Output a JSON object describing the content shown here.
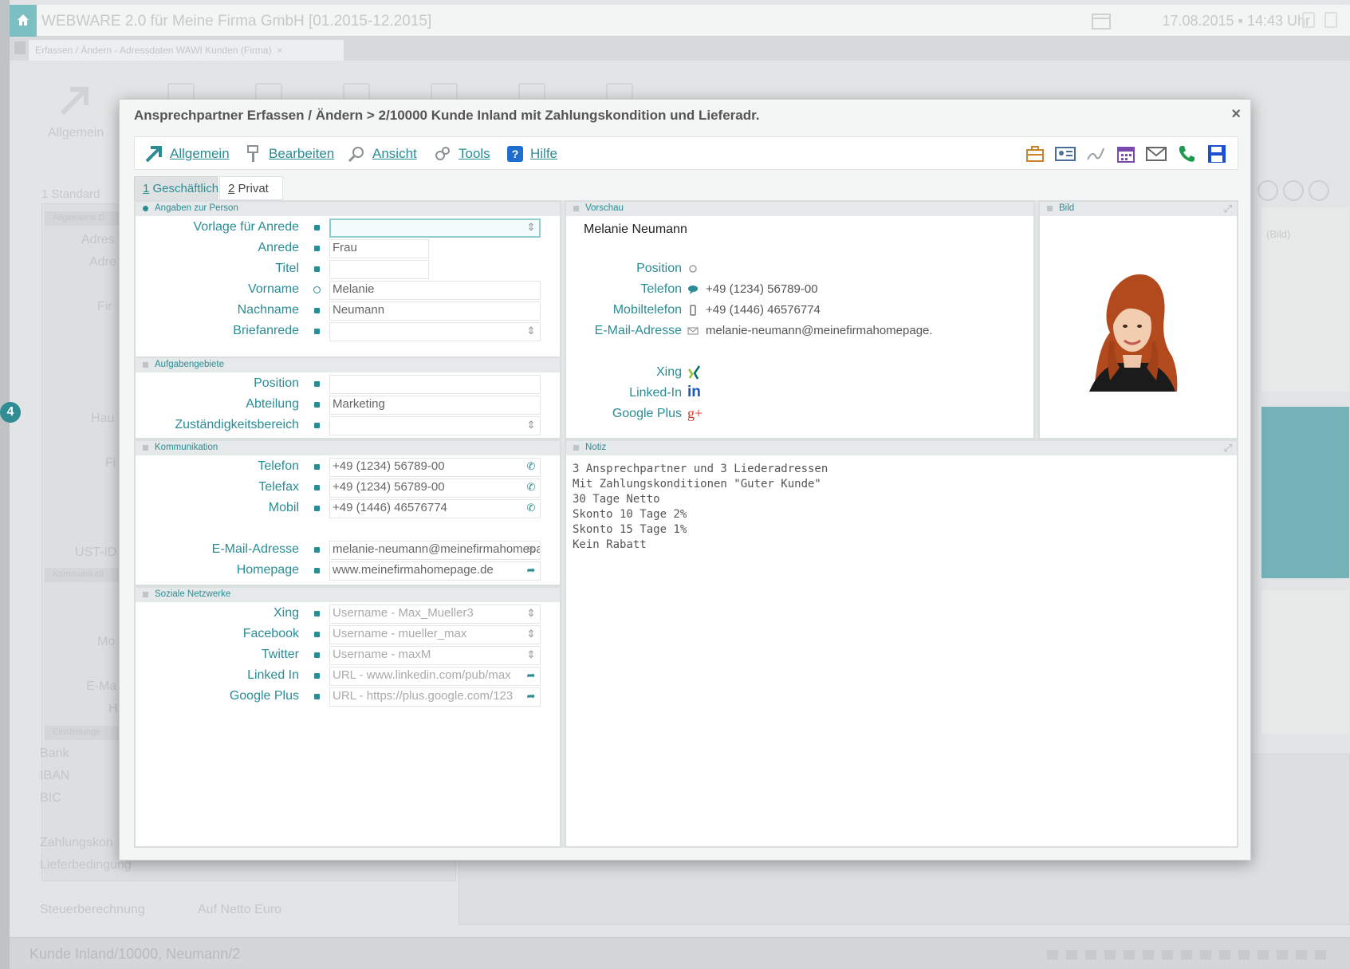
{
  "app": {
    "title": "WEBWARE 2.0 für Meine Firma GmbH  [01.2015-12.2015]",
    "datetime": "17.08.2015 ▪ 14:43 Uhr",
    "tab_label": "Erfassen / Ändern - Adressdaten WAWI Kunden (Firma)",
    "ghost_toolbar_label": "Allgemein",
    "ghost_standard_tab": "1 Standard",
    "bg_labels": [
      "Adres",
      "Adre",
      "Fir",
      "Hau",
      "Fi",
      "UST-ID",
      "Mo",
      "E-Ma",
      "H",
      "Bank",
      "IBAN",
      "BIC",
      "Zahlungskon",
      "Lieferbedingung",
      "Steuerberechnung",
      "Auf Netto Euro"
    ],
    "bg_section_labels": [
      "Allgemeine D",
      "Kommunikati",
      "Einstellunge"
    ],
    "bg_right_note": "(Bild)",
    "status_text": "Kunde Inland/10000, Neumann/2",
    "step_badge": "4",
    "accent_color": "#2a8d94"
  },
  "dialog": {
    "title": "Ansprechpartner Erfassen / Ändern > 2/10000 Kunde Inland mit Zahlungskondition und Lieferadr.",
    "close": "×",
    "toolbar": {
      "allgemein": "Allgemein",
      "bearbeiten": "Bearbeiten",
      "ansicht": "Ansicht",
      "tools": "Tools",
      "hilfe": "Hilfe",
      "right_icons": [
        "briefcase-icon",
        "contact-card-icon",
        "signature-icon",
        "calendar-icon",
        "mail-icon",
        "phone-icon",
        "save-icon"
      ]
    },
    "tabs": [
      {
        "num": "1",
        "label": " Geschäftlich"
      },
      {
        "num": "2",
        "label": " Privat"
      }
    ],
    "sections": {
      "person": "Angaben zur Person",
      "tasks": "Aufgabengebiete",
      "comm": "Kommunikation",
      "social": "Soziale Netzwerke",
      "preview": "Vorschau",
      "picture": "Bild",
      "note": "Notiz"
    },
    "person": {
      "vorlage_label": "Vorlage für Anrede",
      "vorlage_value": "",
      "anrede_label": "Anrede",
      "anrede_value": "Frau",
      "titel_label": "Titel",
      "titel_value": "",
      "vorname_label": "Vorname",
      "vorname_value": "Melanie",
      "nachname_label": "Nachname",
      "nachname_value": "Neumann",
      "brief_label": "Briefanrede",
      "brief_value": ""
    },
    "tasks": {
      "position_label": "Position",
      "position_value": "",
      "abteilung_label": "Abteilung",
      "abteilung_value": "Marketing",
      "zust_label": "Zuständigkeitsbereich",
      "zust_value": ""
    },
    "comm": {
      "telefon_label": "Telefon",
      "telefon_value": "+49 (1234) 56789-00",
      "telefax_label": "Telefax",
      "telefax_value": "+49 (1234) 56789-00",
      "mobil_label": "Mobil",
      "mobil_value": "+49 (1446) 46576774",
      "email_label": "E-Mail-Adresse",
      "email_value": "melanie-neumann@meinefirmahomepage.de",
      "homepage_label": "Homepage",
      "homepage_value": "www.meinefirmahomepage.de"
    },
    "social": {
      "xing_label": "Xing",
      "xing_placeholder": "Username - Max_Mueller3",
      "facebook_label": "Facebook",
      "facebook_placeholder": "Username - mueller_max",
      "twitter_label": "Twitter",
      "twitter_placeholder": "Username - maxM",
      "linkedin_label": "Linked In",
      "linkedin_placeholder": "URL - www.linkedin.com/pub/max",
      "gplus_label": "Google Plus",
      "gplus_placeholder": "URL - https://plus.google.com/123"
    },
    "preview": {
      "name": "Melanie Neumann",
      "position_label": "Position",
      "position_value": "",
      "telefon_label": "Telefon",
      "telefon_value": "+49 (1234) 56789-00",
      "mobil_label": "Mobiltelefon",
      "mobil_value": "+49 (1446) 46576774",
      "email_label": "E-Mail-Adresse",
      "email_value": "melanie-neumann@meinefirmahomepage.",
      "xing_label": "Xing",
      "linkedin_label": "Linked-In",
      "gplus_label": "Google Plus"
    },
    "note": "3 Ansprechpartner und 3 Liederadressen\nMit Zahlungskonditionen \"Guter Kunde\"\n30 Tage Netto\nSkonto 10 Tage 2%\nSkonto 15 Tage 1%\nKein Rabatt"
  }
}
